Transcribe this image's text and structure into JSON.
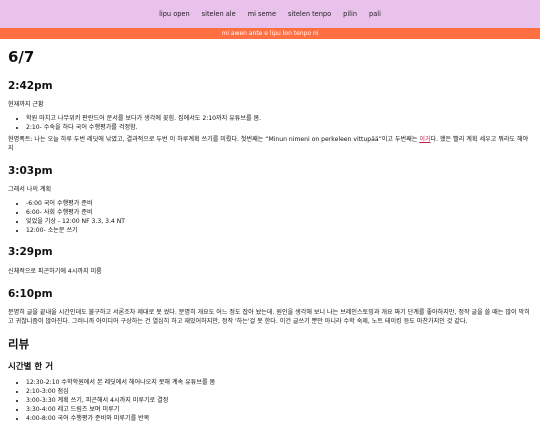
{
  "nav": {
    "items": [
      "lipu open",
      "sitelen ale",
      "mi seme",
      "sitelen tenpo",
      "pilin",
      "pali"
    ]
  },
  "banner": {
    "text": "mi awen ante e lipu lon tenpo ni"
  },
  "page": {
    "title": "6/7",
    "sections": [
      {
        "heading": "2:42pm",
        "intro": "현재까지 근황",
        "items": [
          "학원 마치고 나무위키 판란드어 문서를 보다가 생각에 꽂힘. 집에서도 2:10까지 유튜브를 봄.",
          "2:10- 수숙을 하다 국어 수행평가를 걱정함."
        ],
        "para_before": "현명폭트: 나는 오늘 하루 두번 레딧에 낚였고, 결과적으로 두번 이 하루계획 쓰기를 미뤘다. 첫번째는 “Minun nimeni on perkeleen vittupää”이고 두번째는 ",
        "para_mark": "이거",
        "para_after": "다. 했든 빨리 계획 세우고 뭐라도 해야지"
      },
      {
        "heading": "3:03pm",
        "intro": "그래서 나의 계획",
        "items": [
          "-6:00 국어 수행평가 준비",
          "6:00- 사회 수행평가 준비",
          "잊었을 기상 - 12:00 NF 3.3, 3.4 NT",
          "12:00- 소논문 쓰기"
        ]
      },
      {
        "heading": "3:29pm",
        "intro": "신체적으로 피곤하기에 4시까지 미룸"
      },
      {
        "heading": "6:10pm",
        "para": "분명히 글을 끝내을 시간인데도 불구하고 서론조차 제대로 못 썼다. 분명히 개요도 어느 정도 잡아 놨는데. 원인을 생각해 보니 나는 브레인스토밍과 개요 짜기 단계를 좋아하지만, 정작 글을 쓸 때는 많이 막히고 귀찮니즘이 많아진다. 그러니까 아이디어 구상하는 건 열심히 하고 재밌어하지만, 정작 '하는'걸 못 한다. 이건 글쓰기 뿐만 아니라 수학 숙제, 노트 테이킹 등도 마찬가지인 것 같다."
      }
    ],
    "review": {
      "heading": "리뷰",
      "sub": "시간별 한 거",
      "items": [
        "12:30-2:10 수학학원에서 본 레딧에서 헤어나오지 못해 계속 유튜브를 봄",
        "2:10-3:00 점심",
        "3:00-3:30 계획 쓰기, 피곤해서 4시까지 미루기로 결정",
        "3:30-4:00 레고 드림즈 보며 미루기",
        "4:00-8:00 국어 수행평가 준비와 미루기를 반복"
      ]
    }
  }
}
